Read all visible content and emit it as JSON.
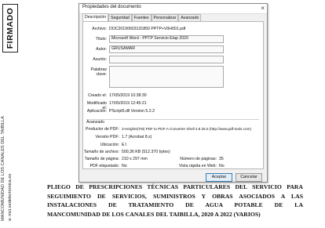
{
  "side": {
    "stamp": "FIRMADO",
    "line1": "MANCOMUNIDAD DE LOS CANALES DEL TAIBILLA",
    "line2": "a: mct.sedelectronica.es"
  },
  "dialog": {
    "title": "Propiedades del documento",
    "close": "×",
    "tabs": [
      "Descripción",
      "Seguridad",
      "Fuentes",
      "Personalizar",
      "Avanzado"
    ],
    "fields": {
      "archivo_label": "Archivo:",
      "archivo_value": "DOC20190603131850 PPTP+V0H001.pdf",
      "titulo_label": "Título:",
      "titulo_value": "Microsoft Word - PPTP Servicio Etap 2020",
      "autor_label": "Autor:",
      "autor_value": "GRUSAMAR",
      "asunto_label": "Asunto:",
      "asunto_value": "",
      "palabras_label": "Palabras clave:",
      "palabras_value": ""
    },
    "dates": {
      "creado_label": "Creado el:",
      "creado_value": "17/05/2019 10:38:30",
      "modificado_label": "Modificado el:",
      "modificado_value": "17/05/2019 12:45:21",
      "aplicacion_label": "Aplicación:",
      "aplicacion_value": "PScript5.dll Version 5.2.2"
    },
    "advanced": {
      "heading": "Avanzado",
      "productor_label": "Productor de PDF:",
      "productor_value": "3-Heights(TM) PDF to PDF-A Converter Shell 4.8.25.5 (http://www.pdf-tools.com)",
      "version_label": "Versión PDF:",
      "version_value": "1.7 (Acrobat 8.x)",
      "ubicacion_label": "Ubicación:",
      "ubicacion_value": "E:\\",
      "tamano_label": "Tamaño de archivo:",
      "tamano_value": "500,36 KB (512.370 bytes)",
      "pagina_label": "Tamaño de página:",
      "pagina_value": "210 x 297 mm",
      "numpag_label": "Número de páginas:",
      "numpag_value": "35",
      "etiquetado_label": "PDF etiquetado:",
      "etiquetado_value": "No",
      "vistaweb_label": "Vista rápida en Web:",
      "vistaweb_value": "No"
    },
    "buttons": {
      "accept": "Aceptar",
      "cancel": "Cancelar"
    }
  },
  "paragraph": {
    "lines": [
      "PLIEGO DE PRESCRIPCIONES TÉCNICAS PARTICULARES DEL SERVICIO PARA",
      "SEGUIMIENTO DE SERVICIOS, SUMINISTROS Y OBRAS ASOCIADOS A LAS",
      "INSTALACIONES DE TRATAMIENTO DE AGUA POTABLE DE LA",
      "MANCOMUNIDAD DE LOS CANALES DEL TAIBILLA, 2020 A 2022 (VARIOS)"
    ]
  }
}
